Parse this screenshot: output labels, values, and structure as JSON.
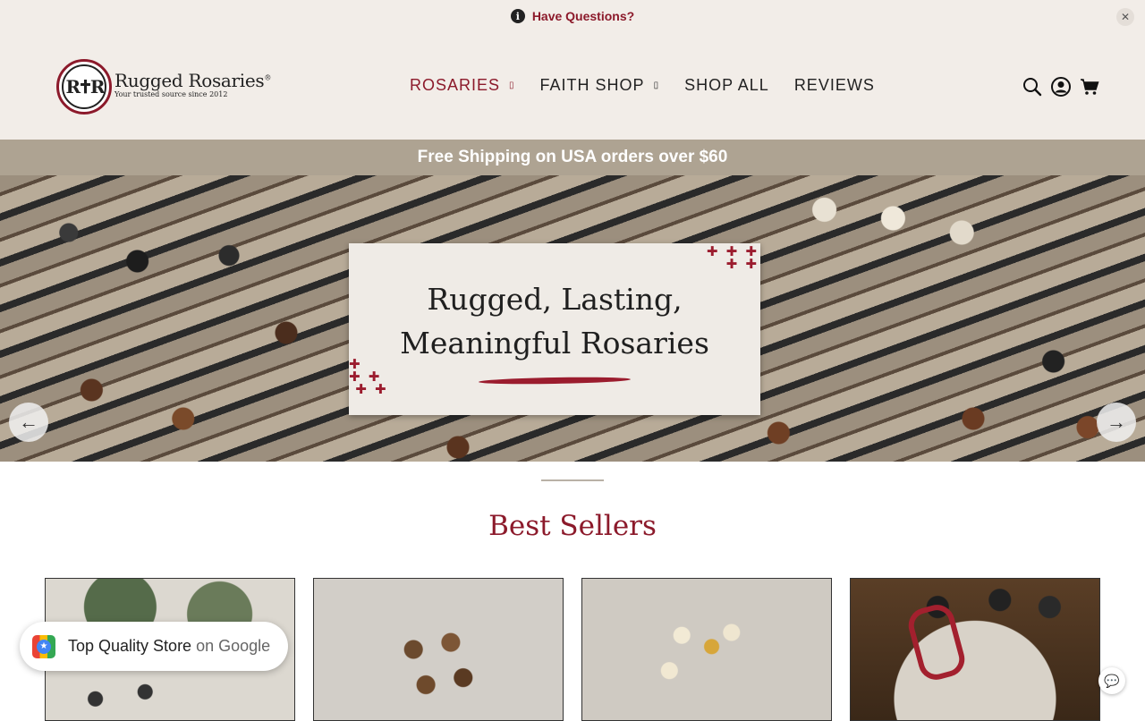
{
  "announcement": {
    "text": "Have Questions?"
  },
  "brand": {
    "name": "Rugged Rosaries",
    "registered": "®",
    "tagline": "Your trusted source since 2012",
    "monogram": "R✝R"
  },
  "nav": [
    {
      "label": "ROSARIES",
      "has_menu": true
    },
    {
      "label": "FAITH SHOP",
      "has_menu": true
    },
    {
      "label": "SHOP ALL",
      "has_menu": false
    },
    {
      "label": "REVIEWS",
      "has_menu": false
    }
  ],
  "header_icons": [
    "search-icon",
    "account-icon",
    "cart-icon"
  ],
  "shipping_banner": "Free Shipping on USA orders over $60",
  "hero": {
    "line1": "Rugged, Lasting,",
    "line2": "Meaningful Rosaries"
  },
  "best_sellers": {
    "title": "Best Sellers"
  },
  "google_badge": {
    "label": "Top Quality Store",
    "suffix": "on Google"
  },
  "colors": {
    "accent": "#8c1a2b",
    "header_bg": "#f2ede8",
    "shipping_bar_bg": "#aea392"
  }
}
